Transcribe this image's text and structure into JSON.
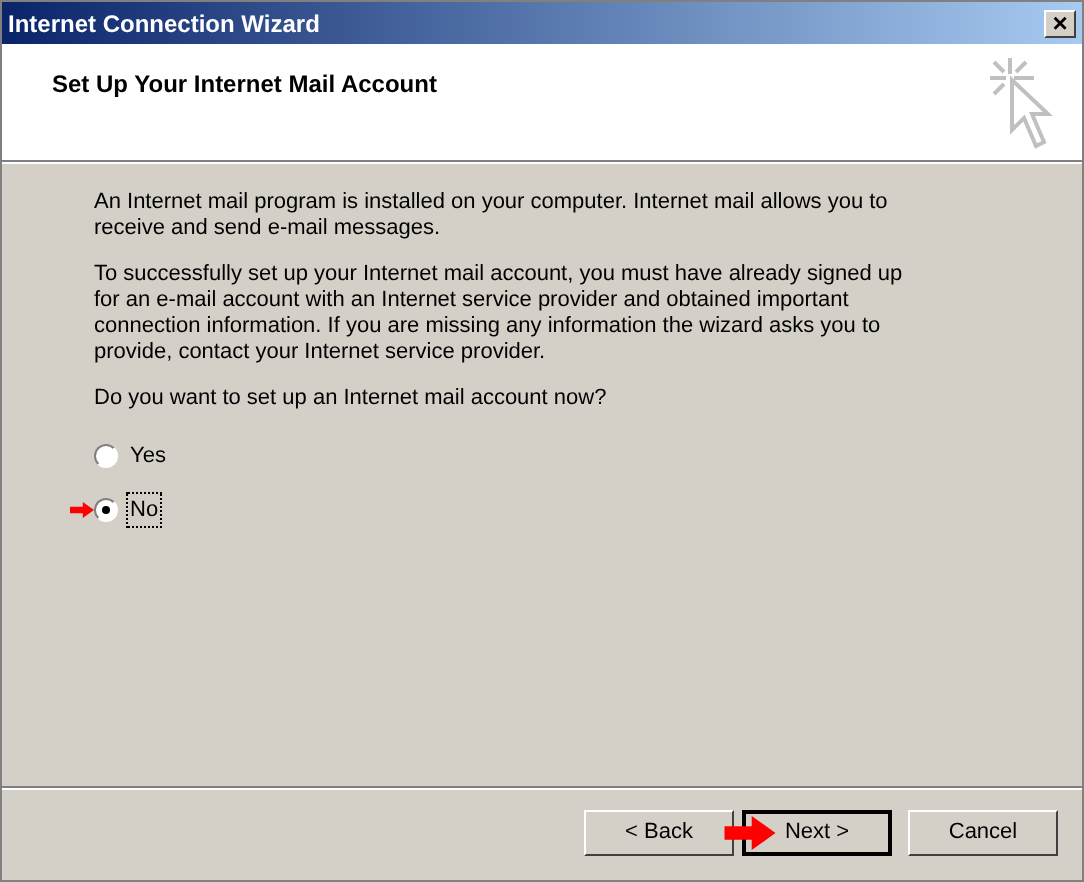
{
  "window": {
    "title": "Internet Connection Wizard",
    "close": "×"
  },
  "header": {
    "title": "Set Up Your Internet Mail Account"
  },
  "paragraphs": [
    "An Internet mail program is installed on your computer. Internet mail allows you to receive and send e-mail messages.",
    "To successfully set up your Internet mail account, you must have already signed up for an e-mail account with an Internet service provider and obtained important connection information. If you are missing any information the wizard asks you to provide, contact your Internet service provider.",
    "Do you want to set up an Internet mail account now?"
  ],
  "options": [
    {
      "label": "Yes",
      "selected": false,
      "pointer": false
    },
    {
      "label": "No",
      "selected": true,
      "pointer": true
    }
  ],
  "buttons": [
    {
      "label": "< Back",
      "default": false,
      "pointer": false
    },
    {
      "label": "Next >",
      "default": true,
      "pointer": true
    },
    {
      "label": "Cancel",
      "default": false,
      "pointer": false
    }
  ]
}
